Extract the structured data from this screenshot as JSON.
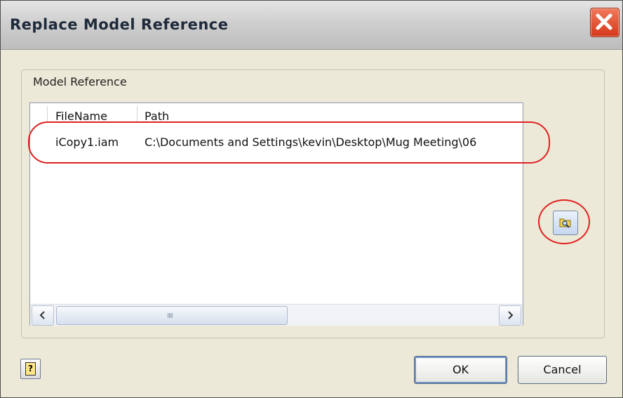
{
  "dialog": {
    "title": "Replace Model Reference",
    "close_icon": "close-icon"
  },
  "group": {
    "label": "Model Reference"
  },
  "list": {
    "columns": [
      "FileName",
      "Path"
    ],
    "rows": [
      {
        "filename": "iCopy1.iam",
        "path": "C:\\Documents and Settings\\kevin\\Desktop\\Mug Meeting\\06"
      }
    ],
    "scroll_left_icon": "chevron-left-icon",
    "scroll_right_icon": "chevron-right-icon",
    "grip_glyph": "IIII"
  },
  "buttons": {
    "browse_icon": "folder-browse-icon",
    "help_icon": "help-icon",
    "help_glyph": "?",
    "ok_label": "OK",
    "cancel_label": "Cancel"
  },
  "annotations": {
    "highlight_color": "#e02020"
  }
}
